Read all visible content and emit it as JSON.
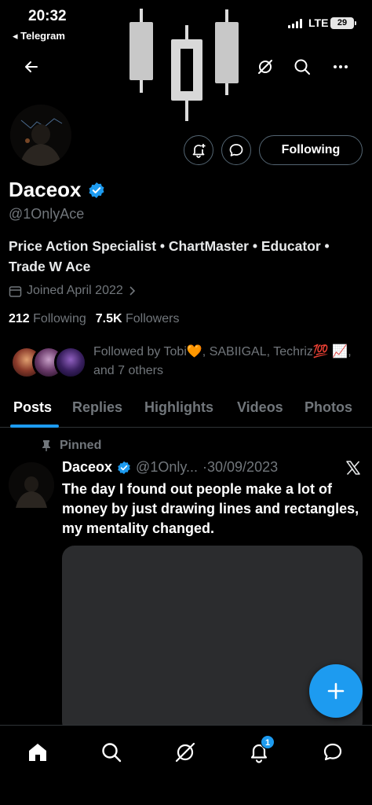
{
  "status_bar": {
    "time": "20:32",
    "back_app": "◂ Telegram",
    "network": "LTE",
    "battery": "29"
  },
  "profile": {
    "name": "Daceox",
    "handle": "@1OnlyAce",
    "bio": "Price Action Specialist • ChartMaster • Educator • Trade W Ace",
    "joined": "Joined April 2022",
    "following_count": "212",
    "following_label": "Following",
    "followers_count": "7.5K",
    "followers_label": "Followers",
    "followed_by": "Followed by Tobi🧡, SABIIGAL, Techriz💯 📈, and 7 others",
    "follow_button": "Following"
  },
  "tabs": [
    "Posts",
    "Replies",
    "Highlights",
    "Videos",
    "Photos"
  ],
  "post": {
    "pinned_label": "Pinned",
    "name": "Daceox",
    "handle": "@1Only...",
    "date": "·30/09/2023",
    "text": "The day I found out people make a lot of money by just drawing lines and rectangles, my mentality changed."
  },
  "nav": {
    "notification_badge": "1"
  },
  "colors": {
    "accent": "#1d9bf0",
    "background": "#000000",
    "muted": "#71767b"
  },
  "icons": [
    "back-arrow-icon",
    "grok-icon",
    "search-icon",
    "more-icon",
    "add-notification-icon",
    "message-icon",
    "verified-icon",
    "calendar-icon",
    "chevron-right-icon",
    "pin-icon",
    "x-logo-icon",
    "plus-icon",
    "home-icon",
    "notifications-icon",
    "messages-icon"
  ]
}
